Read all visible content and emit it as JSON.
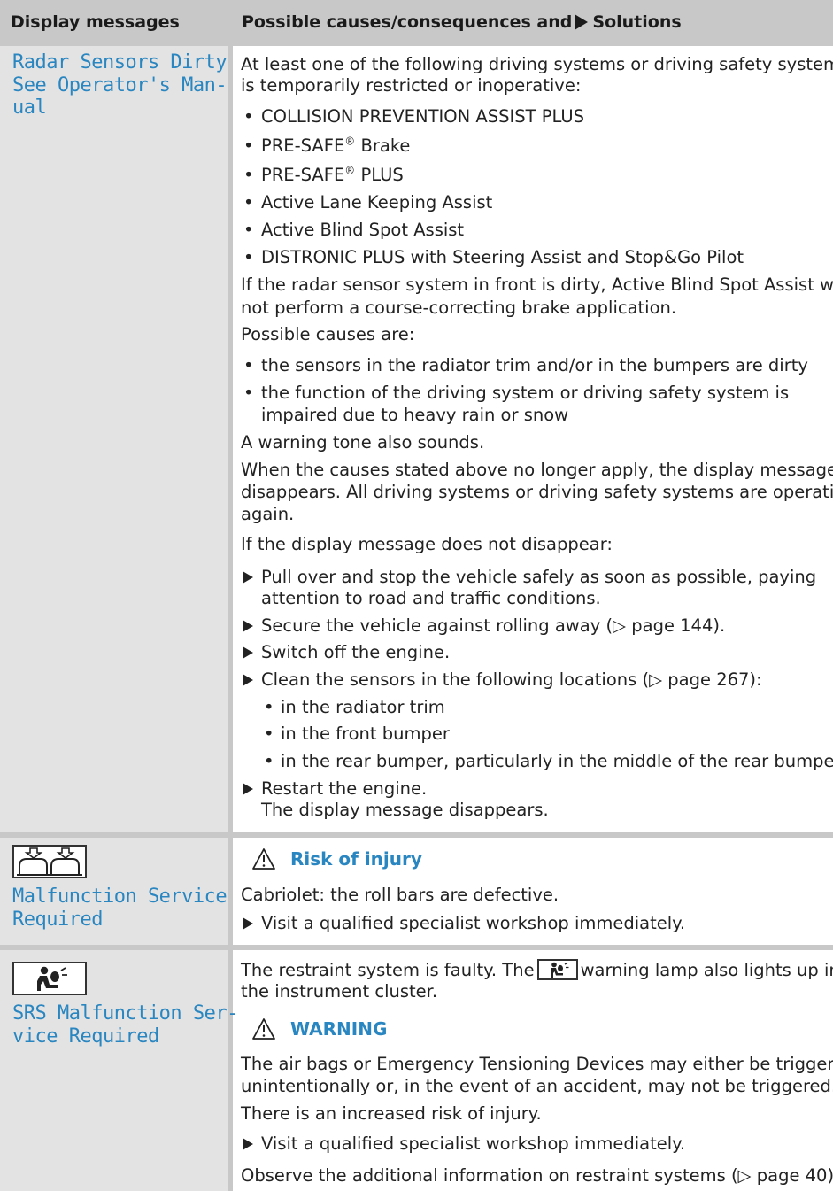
{
  "header": {
    "left": "Display messages",
    "right_prefix": "Possible causes/consequences and",
    "right_suffix": "Solutions"
  },
  "rows": [
    {
      "message_lines": [
        "Radar Sensors Dirty",
        "See Operator's Man-",
        "ual"
      ],
      "intro": [
        "At least one of the following driving systems or driving safety systems",
        "is temporarily restricted or inoperative:"
      ],
      "systems": [
        "COLLISION PREVENTION ASSIST PLUS",
        "PRE-SAFE",
        "PRE-SAFE",
        "Active Lane Keeping Assist",
        "Active Blind Spot Assist",
        "DISTRONIC PLUS with Steering Assist and Stop&Go Pilot"
      ],
      "system_suffix": {
        "reg": "®",
        "brake": " Brake",
        "plus": " PLUS"
      },
      "dirty_note": [
        "If the radar sensor system in front is dirty, Active Blind Spot Assist will",
        "not perform a course-correcting brake application."
      ],
      "causes_label": "Possible causes are:",
      "causes": [
        [
          "the sensors in the radiator trim and/or in the bumpers are dirty"
        ],
        [
          "the function of the driving system or driving safety system is",
          "impaired due to heavy rain or snow"
        ]
      ],
      "tone": "A warning tone also sounds.",
      "clear_note": [
        "When the causes stated above no longer apply, the display message",
        "disappears. All driving systems or driving safety systems are operative",
        "again."
      ],
      "not_disappear": "If the display message does not disappear:",
      "steps": [
        [
          "Pull over and stop the vehicle safely as soon as possible, paying",
          "attention to road and traffic conditions."
        ],
        [
          "Secure the vehicle against rolling away (▷ page 144)."
        ],
        [
          "Switch off the engine."
        ],
        [
          "Clean the sensors in the following locations (▷ page 267):"
        ]
      ],
      "locations": [
        "in the radiator trim",
        "in the front bumper",
        "in the rear bumper, particularly in the middle of the rear bumper"
      ],
      "restart": [
        "Restart the engine.",
        "The display message disappears."
      ]
    },
    {
      "icon": "roll-bar-icon",
      "message_lines": [
        "Malfunction Service",
        "Required"
      ],
      "warning_title": "Risk of injury",
      "text": "Cabriolet: the roll bars are defective.",
      "step": "Visit a qualified specialist workshop immediately."
    },
    {
      "icon": "airbag-icon",
      "message_lines": [
        "SRS Malfunction Ser-",
        "vice Required"
      ],
      "intro_a": "The restraint system is faulty. The",
      "intro_b": "warning lamp also lights up in",
      "intro_c": "the instrument cluster.",
      "warning_title": "WARNING",
      "warning_text": [
        "The air bags or Emergency Tensioning Devices may either be triggered",
        "unintentionally or, in the event of an accident, may not be triggered."
      ],
      "risk": "There is an increased risk of injury.",
      "step": "Visit a qualified specialist workshop immediately.",
      "observe": "Observe the additional information on restraint systems (▷ page 40)."
    }
  ],
  "colors": {
    "header_bg": "#c8c8c8",
    "left_col_bg": "#e3e3e3",
    "message_blue": "#2a86c0"
  }
}
